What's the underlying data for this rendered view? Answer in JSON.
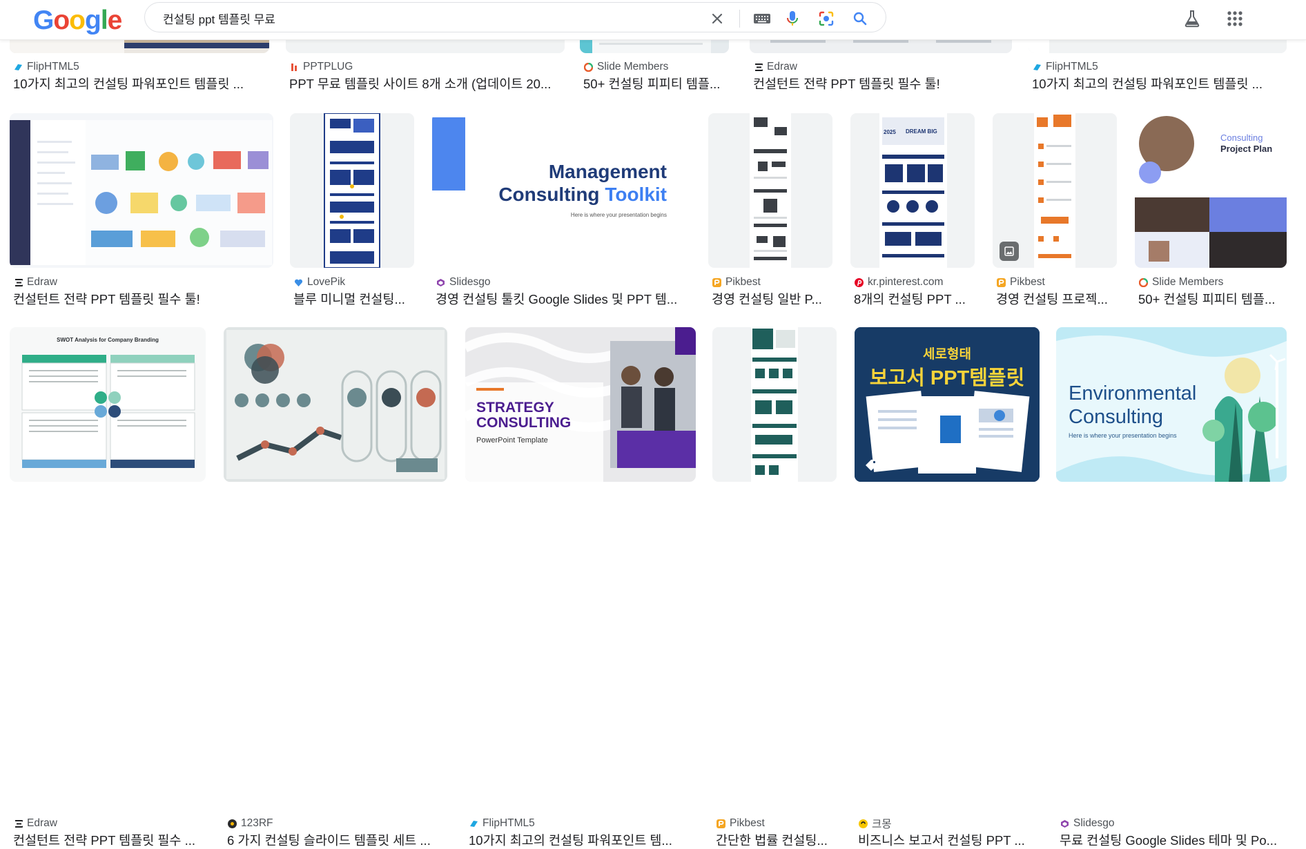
{
  "search": {
    "query": "컨설팅 ppt 템플릿 무료",
    "logo": [
      "G",
      "o",
      "o",
      "g",
      "l",
      "e"
    ],
    "logo_colors": [
      "#4285F4",
      "#EA4335",
      "#FBBC05",
      "#4285F4",
      "#34A853",
      "#EA4335"
    ]
  },
  "icons": {
    "clear": "close-icon",
    "keyboard": "keyboard-icon",
    "voice": "microphone-icon",
    "lens": "google-lens-icon",
    "search": "search-icon",
    "labs": "flask-icon",
    "apps": "apps-grid-icon"
  },
  "results": {
    "row1": [
      {
        "source": "FlipHTML5",
        "title": "10가지 최고의 컨설팅 파워포인트 템플릿 ...",
        "color": "#1ea7e1"
      },
      {
        "source": "PPTPLUG",
        "title": "PPT 무료 템플릿 사이트 8개 소개 (업데이트 20...",
        "color": "#e8543a"
      },
      {
        "source": "Slide Members",
        "title": "50+ 컨설팅 피피티 템플...",
        "color": "#e85c2b"
      },
      {
        "source": "Edraw",
        "title": "컨설턴트 전략 PPT 템플릿 필수 툴!",
        "color": "#202124"
      },
      {
        "source": "FlipHTML5",
        "title": "10가지 최고의 컨설팅 파워포인트 템플릿 ...",
        "color": "#1ea7e1"
      }
    ],
    "row2": [
      {
        "source": "Edraw",
        "title": "컨설턴트 전략 PPT 템플릿 필수 툴!",
        "color": "#202124"
      },
      {
        "source": "LovePik",
        "title": "블루 미니멀 컨설팅...",
        "color": "#3a8ee6"
      },
      {
        "source": "Slidesgo",
        "title": "경영 컨설팅 툴킷 Google Slides 및 PPT 템...",
        "color": "#8e44ad",
        "thumb_line1": "Management",
        "thumb_line2a": "Consulting",
        "thumb_line2b": "Toolkit",
        "thumb_sub": "Here is where your presentation begins"
      },
      {
        "source": "Pikbest",
        "title": "경영 컨설팅 일반 P...",
        "color": "#f5a623"
      },
      {
        "source": "kr.pinterest.com",
        "title": "8개의 컨설팅 PPT ...",
        "color": "#e60023",
        "thumb_text": "DREAM BIG"
      },
      {
        "source": "Pikbest",
        "title": "경영 컨설팅 프로젝...",
        "color": "#f5a623"
      },
      {
        "source": "Slide Members",
        "title": "50+ 컨설팅 피피티 템플...",
        "color": "#e85c2b",
        "thumb_line1": "Consulting",
        "thumb_line2": "Project Plan"
      }
    ],
    "row3": [
      {
        "source": "Edraw",
        "title": "컨설턴트 전략 PPT 템플릿 필수 ...",
        "color": "#202124",
        "thumb_title": "SWOT Analysis for Company Branding"
      },
      {
        "source": "123RF",
        "title": "6 가지 컨설팅 슬라이드 템플릿 세트 ...",
        "color": "#2b2b2b"
      },
      {
        "source": "FlipHTML5",
        "title": "10가지 최고의 컨설팅 파워포인트 템...",
        "color": "#1ea7e1",
        "thumb_line1": "STRATEGY",
        "thumb_line2": "CONSULTING",
        "thumb_sub": "PowerPoint Template"
      },
      {
        "source": "Pikbest",
        "title": "간단한 법률 컨설팅...",
        "color": "#f5a623"
      },
      {
        "source": "크몽",
        "title": "비즈니스 보고서 컨설팅 PPT ...",
        "color": "#f7c600",
        "thumb_line1": "세로형태",
        "thumb_line2": "보고서 PPT템플릿"
      },
      {
        "source": "Slidesgo",
        "title": "무료 컨설팅 Google Slides 테마 및 Po...",
        "color": "#8e44ad",
        "thumb_line1": "Environmental",
        "thumb_line2": "Consulting",
        "thumb_sub": "Here is where your presentation begins"
      }
    ]
  }
}
